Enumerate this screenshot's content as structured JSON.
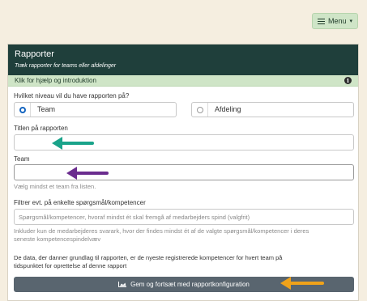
{
  "menu": {
    "label": "Menu",
    "caret": "▾"
  },
  "panel": {
    "title": "Rapporter",
    "subtitle": "Træk rapporter for teams eller afdelinger",
    "help": "Klik for hjælp og introduktion",
    "info_glyph": "i"
  },
  "level": {
    "question": "Hvilket niveau vil du have rapporten på?",
    "options": [
      {
        "label": "Team",
        "selected": true
      },
      {
        "label": "Afdeling",
        "selected": false
      }
    ]
  },
  "title_field": {
    "label": "Titlen på rapporten",
    "value": ""
  },
  "team_field": {
    "label": "Team",
    "value": "",
    "help": "Vælg mindst et team fra listen."
  },
  "filter": {
    "label": "Filtrer evt. på enkelte spørgsmål/kompetencer",
    "placeholder": "Spørgsmål/kompetencer, hvoraf mindst ét skal fremgå af medarbejders spind (valgfrit)",
    "help_line1": "Inkluder kun de medarbejderes svarark, hvor der findes mindst ét af de valgte spørgsmål/kompetencer i deres",
    "help_line2": "seneste kompetencespindelvæv"
  },
  "info": {
    "line1": "De data, der danner grundlag til rapporten, er de nyeste registrerede kompetencer for hvert team på",
    "line2": "tidspunktet for oprettelse af denne rapport"
  },
  "save_button": {
    "label": "Gem og fortsæt med rapportkonfiguration"
  },
  "colors": {
    "header": "#1f3f3b",
    "help_bar": "#cfe5c7",
    "button": "#59656f",
    "arrow_teal": "#1aa38a",
    "arrow_purple": "#6b2d8f",
    "arrow_orange": "#f0a21a"
  },
  "icons": [
    "menu-icon",
    "caret-down-icon",
    "info-icon",
    "chart-area-icon",
    "arrow-left-icon"
  ]
}
